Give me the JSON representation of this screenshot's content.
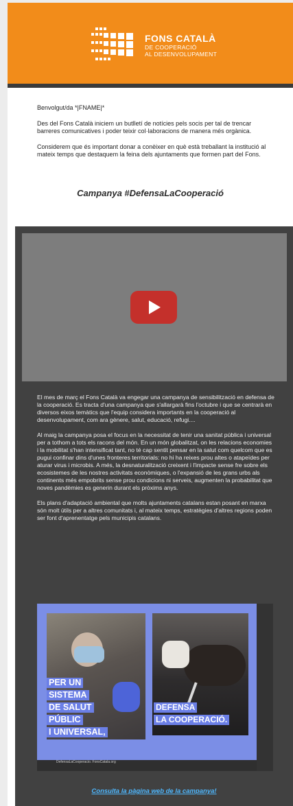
{
  "header": {
    "logo_title": "FONS CATALÀ",
    "logo_line2": "DE COOPERACIÓ",
    "logo_line3": "AL DESENVOLUPAMENT"
  },
  "intro": {
    "greeting": "Benvolgut/da *|FNAME|*",
    "paragraph1": "Des del Fons Català iniciem un butlletí de notícies pels socis per tal de trencar barreres comunicatives i poder teixir col·laboracions de manera més orgànica.",
    "paragraph2": "Considerem que és important donar a conèixer en què està treballant la institució al mateix temps que destaquem la feina dels ajuntaments que formen part del Fons."
  },
  "campaign": {
    "title": "Campanya #DefensaLaCooperació",
    "paragraph1": "El mes de març el Fons Català va engegar una campanya de sensibilització en defensa de la cooperació. Es tracta d'una campanya que s'allargarà fins l'octubre i que se centrarà en diversos eixos temàtics que l'equip considera importants en la cooperació al desenvolupament, com ara gènere, salut, educació, refugi....",
    "paragraph2": "Al maig la campanya posa el focus en la necessitat de tenir una sanitat pública i universal per a tothom a tots els racons del món. En un món globalitzat, on les relacions economies i la mobilitat s'han intensificat tant, no té cap sentit pensar en la salut com quelcom que es pugui confinar dins d'unes fronteres territorials: no hi ha reixes prou altes o atapeïdes per aturar virus i microbis. A més, la desnaturalització creixent i l'impacte sense fre sobre els ecosistemes de les nostres activitats econòmiques, o l'expansió de les grans urbs als continents més empobrits sense prou condicions ni serveis, augmenten la probabilitat que noves pandèmies es generin durant els pròxims anys.",
    "paragraph3": "Els plans d'adaptació ambiental que molts ajuntaments catalans estan posant en marxa són molt útils per a altres comunitats i, al mateix temps, estratègies d'altres regions poden ser font d'aprenentatge pels municipis catalans.",
    "poster_slogan1": [
      "PER UN",
      "SISTEMA",
      "DE SALUT",
      "PÚBLIC",
      "I UNIVERSAL,"
    ],
    "poster_slogan2": [
      "DEFENSA",
      "LA COOPERACIÓ."
    ],
    "poster_footer": "DefensaLaCooperacio. FonsCatala.org",
    "cta": "Consulta la pàgina web de la campanya!"
  },
  "colors": {
    "brand_orange": "#f28c1a",
    "dark_panel": "#414141",
    "link": "#4fb8ff",
    "poster_blue": "#7b8ee6"
  }
}
